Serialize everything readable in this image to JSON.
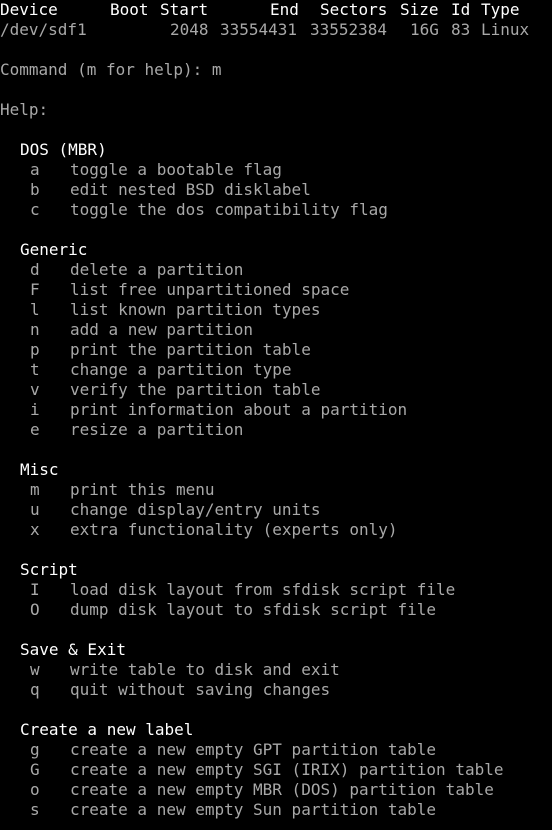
{
  "terminal": {
    "header": {
      "device": "Device",
      "boot": "Boot",
      "start": "Start",
      "end": "End",
      "sectors": "Sectors",
      "size": "Size",
      "id": "Id",
      "type": "Type"
    },
    "partition": {
      "device": "/dev/sdf1",
      "start": "2048",
      "end": "33554431",
      "sectors": "33552384",
      "size": "16G",
      "id": "83",
      "type": "Linux"
    },
    "prompt": "Command (m for help): m",
    "help_label": "Help:",
    "sections": [
      {
        "title": "DOS (MBR)",
        "commands": [
          {
            "key": "a",
            "desc": "toggle a bootable flag"
          },
          {
            "key": "b",
            "desc": "edit nested BSD disklabel"
          },
          {
            "key": "c",
            "desc": "toggle the dos compatibility flag"
          }
        ]
      },
      {
        "title": "Generic",
        "commands": [
          {
            "key": "d",
            "desc": "delete a partition"
          },
          {
            "key": "F",
            "desc": "list free unpartitioned space"
          },
          {
            "key": "l",
            "desc": "list known partition types"
          },
          {
            "key": "n",
            "desc": "add a new partition"
          },
          {
            "key": "p",
            "desc": "print the partition table"
          },
          {
            "key": "t",
            "desc": "change a partition type"
          },
          {
            "key": "v",
            "desc": "verify the partition table"
          },
          {
            "key": "i",
            "desc": "print information about a partition"
          },
          {
            "key": "e",
            "desc": "resize a partition"
          }
        ]
      },
      {
        "title": "Misc",
        "commands": [
          {
            "key": "m",
            "desc": "print this menu"
          },
          {
            "key": "u",
            "desc": "change display/entry units"
          },
          {
            "key": "x",
            "desc": "extra functionality (experts only)"
          }
        ]
      },
      {
        "title": "Script",
        "commands": [
          {
            "key": "I",
            "desc": "load disk layout from sfdisk script file"
          },
          {
            "key": "O",
            "desc": "dump disk layout to sfdisk script file"
          }
        ]
      },
      {
        "title": "Save & Exit",
        "commands": [
          {
            "key": "w",
            "desc": "write table to disk and exit"
          },
          {
            "key": "q",
            "desc": "quit without saving changes"
          }
        ]
      },
      {
        "title": "Create a new label",
        "commands": [
          {
            "key": "g",
            "desc": "create a new empty GPT partition table"
          },
          {
            "key": "G",
            "desc": "create a new empty SGI (IRIX) partition table"
          },
          {
            "key": "o",
            "desc": "create a new empty MBR (DOS) partition table"
          },
          {
            "key": "s",
            "desc": "create a new empty Sun partition table"
          }
        ]
      }
    ],
    "colors": {
      "background": "#000000",
      "text": "#a8a8a8",
      "bright_text": "#ffffff"
    }
  }
}
